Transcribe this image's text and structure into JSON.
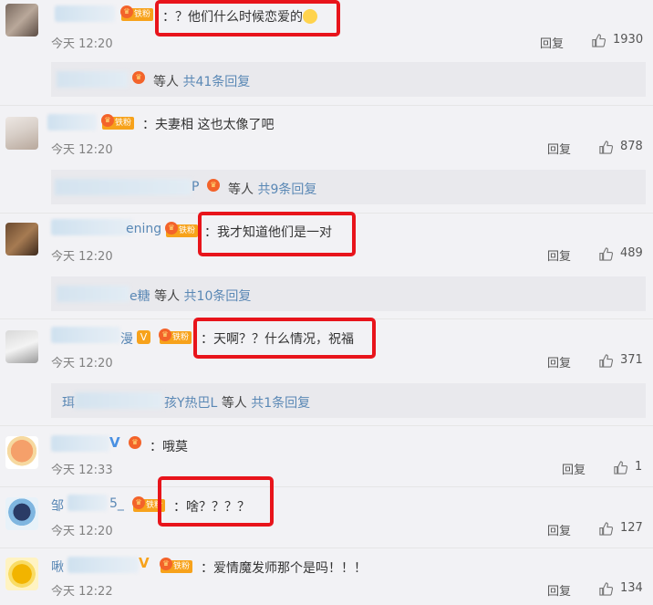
{
  "comments": [
    {
      "name_suffix": "",
      "badge": "铁粉",
      "text": "：？他们什么时候恋爱的",
      "time": "今天 12:20",
      "reply_label": "回复",
      "likes": "1930",
      "replies": {
        "name": "",
        "others": "等人",
        "count": "共41条回复"
      }
    },
    {
      "name_suffix": "",
      "badge": "铁粉",
      "text": "：夫妻相 这也太像了吧",
      "time": "今天 12:20",
      "reply_label": "回复",
      "likes": "878",
      "replies": {
        "name": "P",
        "others": "等人",
        "count": "共9条回复"
      }
    },
    {
      "name_suffix": "ening",
      "badge": "铁粉",
      "text": "：我才知道他们是一对",
      "time": "今天 12:20",
      "reply_label": "回复",
      "likes": "489",
      "replies": {
        "name": "e糖",
        "others": "等人",
        "count": "共10条回复"
      }
    },
    {
      "name_suffix": "漫",
      "badge": "铁粉",
      "text": "：天啊？？什么情况，祝福",
      "time": "今天 12:20",
      "reply_label": "回复",
      "likes": "371",
      "replies": {
        "name_prefix": "珥",
        "name": "孩Y热巴L",
        "others": "等人",
        "count": "共1条回复"
      }
    },
    {
      "name_suffix": "",
      "badge": "",
      "text": "：哦莫",
      "time": "今天 12:33",
      "reply_label": "回复",
      "likes": "1"
    },
    {
      "name_prefix": "邹",
      "name_suffix": "5_",
      "badge": "铁粉",
      "text": "：啥？？？？",
      "time": "今天 12:20",
      "reply_label": "回复",
      "likes": "127"
    },
    {
      "name_prefix": "啾",
      "name_suffix": "",
      "badge": "铁粉",
      "text": "：爱情魔发师那个是吗！！！",
      "time": "今天 12:22",
      "reply_label": "回复",
      "likes": "134"
    }
  ],
  "colors": {
    "accent": "#5a88b5",
    "highlight": "#e8141b",
    "badge": "#f7a21b"
  },
  "icons": {
    "like": "thumbs-up-icon",
    "badge": "crown-icon",
    "verified": "v-icon"
  }
}
